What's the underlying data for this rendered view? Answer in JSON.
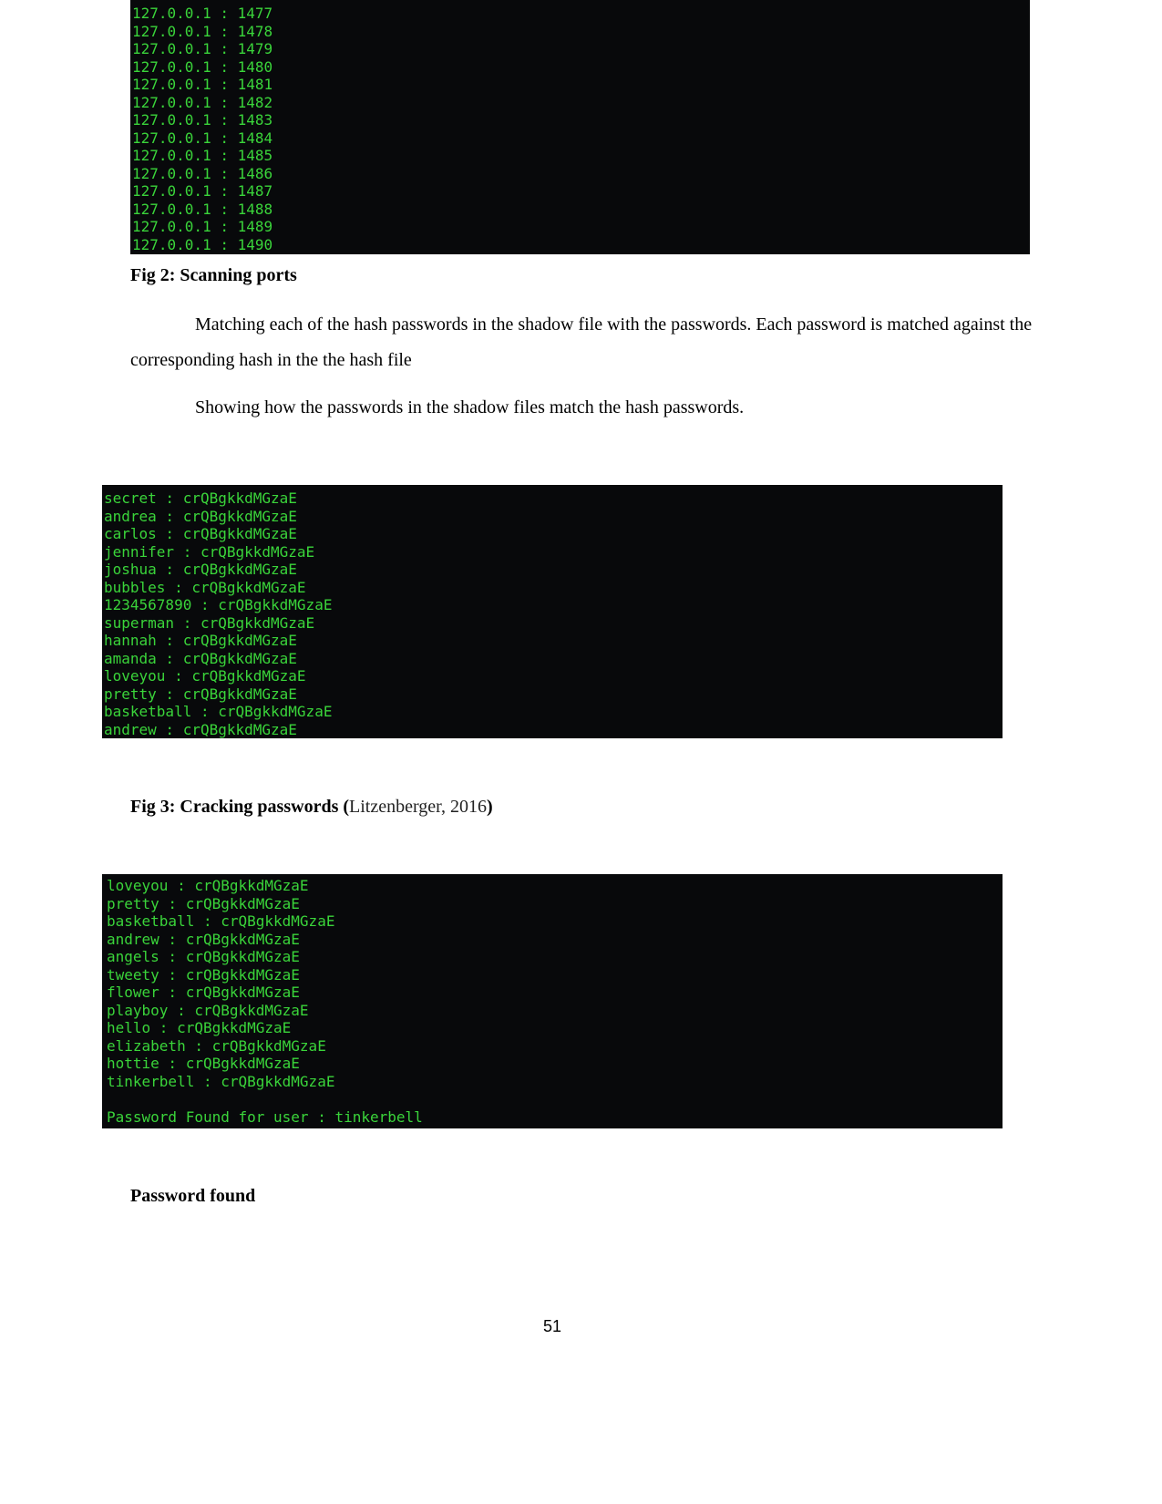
{
  "terminal_ports": {
    "lines": [
      "127.0.0.1 : 1477",
      "127.0.0.1 : 1478",
      "127.0.0.1 : 1479",
      "127.0.0.1 : 1480",
      "127.0.0.1 : 1481",
      "127.0.0.1 : 1482",
      "127.0.0.1 : 1483",
      "127.0.0.1 : 1484",
      "127.0.0.1 : 1485",
      "127.0.0.1 : 1486",
      "127.0.0.1 : 1487",
      "127.0.0.1 : 1488",
      "127.0.0.1 : 1489",
      "127.0.0.1 : 1490"
    ]
  },
  "fig2_caption": "Fig 2: Scanning ports",
  "paragraph1": "Matching each of the hash passwords in the shadow file with the passwords. Each password is matched against the corresponding hash in the the hash file",
  "paragraph2": "Showing how the passwords in the shadow files match the hash passwords.",
  "terminal_crack1": {
    "lines": [
      "secret : crQBgkkdMGzaE",
      "andrea : crQBgkkdMGzaE",
      "carlos : crQBgkkdMGzaE",
      "jennifer : crQBgkkdMGzaE",
      "joshua : crQBgkkdMGzaE",
      "bubbles : crQBgkkdMGzaE",
      "1234567890 : crQBgkkdMGzaE",
      "superman : crQBgkkdMGzaE",
      "hannah : crQBgkkdMGzaE",
      "amanda : crQBgkkdMGzaE",
      "loveyou : crQBgkkdMGzaE",
      "pretty : crQBgkkdMGzaE",
      "basketball : crQBgkkdMGzaE",
      "andrew : crQBgkkdMGzaE"
    ]
  },
  "fig3_caption": {
    "bold_start": "Fig 3: Cracking passwords (",
    "citation": "Litzenberger, 2016",
    "bold_end": ")"
  },
  "terminal_crack2": {
    "lines": [
      "loveyou : crQBgkkdMGzaE",
      "pretty : crQBgkkdMGzaE",
      "basketball : crQBgkkdMGzaE",
      "andrew : crQBgkkdMGzaE",
      "angels : crQBgkkdMGzaE",
      "tweety : crQBgkkdMGzaE",
      "flower : crQBgkkdMGzaE",
      "playboy : crQBgkkdMGzaE",
      "hello : crQBgkkdMGzaE",
      "elizabeth : crQBgkkdMGzaE",
      "hottie : crQBgkkdMGzaE",
      "tinkerbell : crQBgkkdMGzaE",
      "",
      "Password Found for user : tinkerbell"
    ]
  },
  "password_found_heading": "Password found",
  "page_number": "51",
  "colors": {
    "terminal_bg": "#08090b",
    "terminal_text": "#3ad43a"
  }
}
